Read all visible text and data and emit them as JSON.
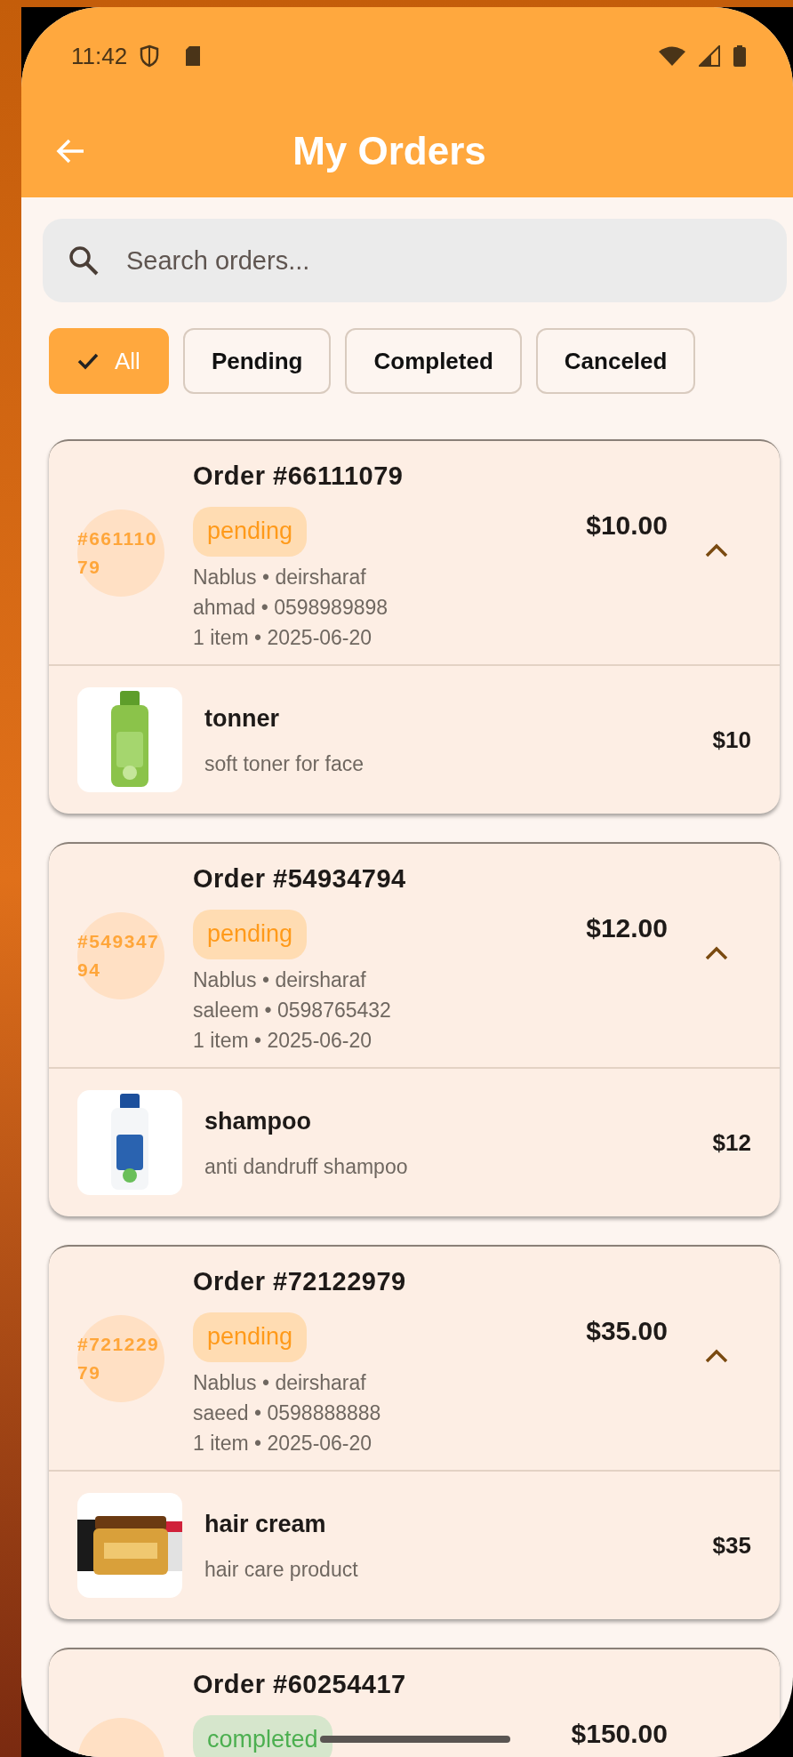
{
  "status_bar": {
    "time": "11:42"
  },
  "header": {
    "title": "My Orders"
  },
  "search": {
    "placeholder": "Search orders..."
  },
  "filters": [
    {
      "label": "All",
      "selected": true
    },
    {
      "label": "Pending",
      "selected": false
    },
    {
      "label": "Completed",
      "selected": false
    },
    {
      "label": "Canceled",
      "selected": false
    }
  ],
  "orders": [
    {
      "avatar": "#66111079",
      "title": "Order #66111079",
      "status": "pending",
      "total": "$10.00",
      "location": "Nablus • deirsharaf",
      "contact": "ahmad • 0598989898",
      "summary": "1 item • 2025-06-20",
      "expanded": true,
      "items": [
        {
          "name": "tonner",
          "description": "soft toner for face",
          "price": "$10",
          "kind": "picture"
        }
      ]
    },
    {
      "avatar": "#54934794",
      "title": "Order #54934794",
      "status": "pending",
      "total": "$12.00",
      "location": "Nablus • deirsharaf",
      "contact": "saleem • 0598765432",
      "summary": "1 item • 2025-06-20",
      "expanded": true,
      "items": [
        {
          "name": "shampoo",
          "description": "anti dandruff shampoo",
          "price": "$12",
          "kind": "picture"
        }
      ]
    },
    {
      "avatar": "#72122979",
      "title": "Order #72122979",
      "status": "pending",
      "total": "$35.00",
      "location": "Nablus • deirsharaf",
      "contact": "saeed • 0598888888",
      "summary": "1 item • 2025-06-20",
      "expanded": true,
      "items": [
        {
          "name": "hair cream",
          "description": "hair care product",
          "price": "$35",
          "kind": "picture"
        }
      ]
    },
    {
      "title": "Order #60254417",
      "status": "completed",
      "total": "$150.00"
    }
  ]
}
